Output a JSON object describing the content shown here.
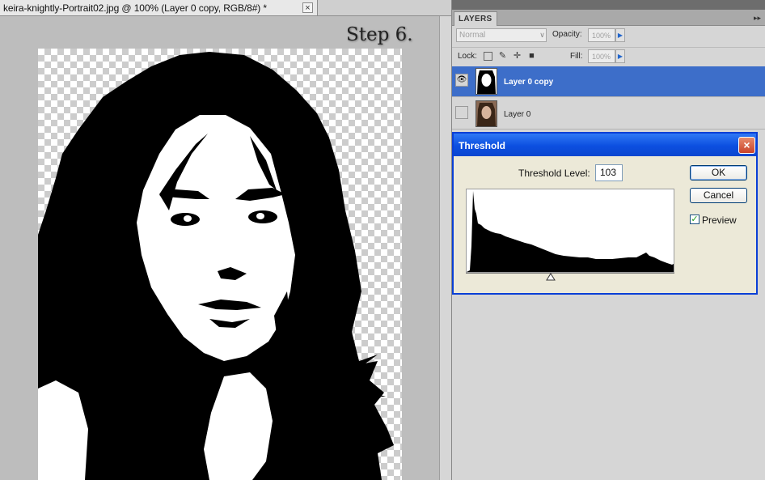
{
  "document": {
    "tab_title": "keira-knightly-Portrait02.jpg @ 100% (Layer 0 copy, RGB/8#) *",
    "close_glyph": "×",
    "caption": "Step 6."
  },
  "layers_panel": {
    "tab_label": "LAYERS",
    "collapse_glyph": "▸▸",
    "blend_mode": "Normal",
    "opacity_label": "Opacity:",
    "opacity_value": "100%",
    "lock_label": "Lock:",
    "fill_label": "Fill:",
    "fill_value": "100%",
    "lock_icons": [
      "lock-transparent-icon",
      "brush-icon",
      "move-icon",
      "lock-icon"
    ],
    "layers": [
      {
        "name": "Layer 0 copy",
        "visible": true,
        "selected": true
      },
      {
        "name": "Layer 0",
        "visible": false,
        "selected": false
      }
    ]
  },
  "threshold_dialog": {
    "title": "Threshold",
    "close_glyph": "×",
    "level_label": "Threshold Level:",
    "level_value": "103",
    "ok_label": "OK",
    "cancel_label": "Cancel",
    "preview_label": "Preview",
    "preview_checked": true
  },
  "colors": {
    "selection_blue": "#3d6ec9",
    "dialog_title_blue": "#0c4fe0",
    "close_red": "#c9432a"
  }
}
